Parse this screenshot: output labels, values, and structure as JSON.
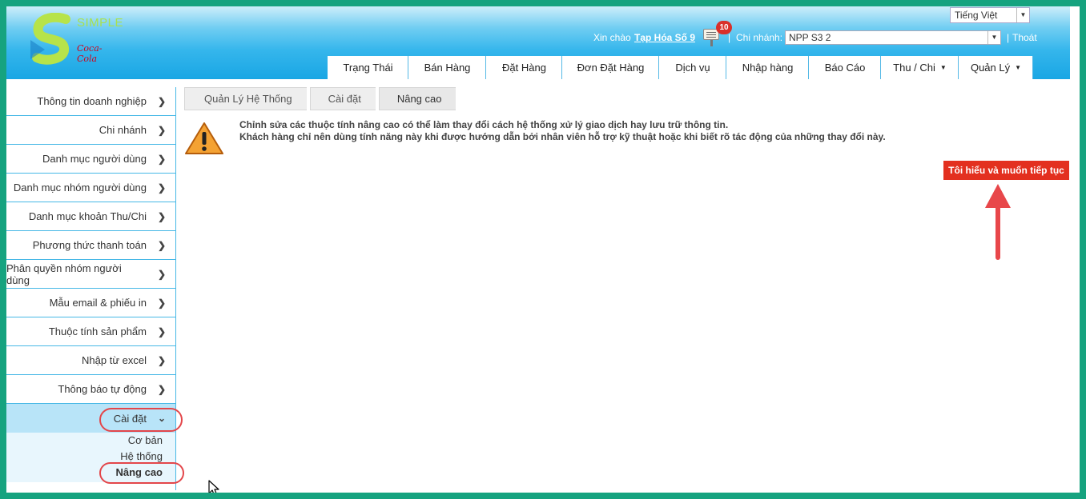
{
  "header": {
    "logo_text": "SIMPLE",
    "logo_sub": "Coca-Cola",
    "language": "Tiếng Việt",
    "greeting": "Xin chào",
    "shop_name": "Tạp Hóa Số 9",
    "notification_count": "10",
    "separator": "|",
    "branch_label": "Chi nhánh:",
    "branch_value": "NPP S3 2",
    "logout": "Thoát"
  },
  "tabs": [
    {
      "label": "Trạng Thái",
      "dropdown": false
    },
    {
      "label": "Bán Hàng",
      "dropdown": false
    },
    {
      "label": "Đặt Hàng",
      "dropdown": false
    },
    {
      "label": "Đơn Đặt Hàng",
      "dropdown": false
    },
    {
      "label": "Dịch vụ",
      "dropdown": false
    },
    {
      "label": "Nhập hàng",
      "dropdown": false
    },
    {
      "label": "Báo Cáo",
      "dropdown": false
    },
    {
      "label": "Thu / Chi",
      "dropdown": true
    },
    {
      "label": "Quản Lý",
      "dropdown": true
    }
  ],
  "sidebar": {
    "items": [
      {
        "label": "Thông tin doanh nghiệp"
      },
      {
        "label": "Chi nhánh"
      },
      {
        "label": "Danh mục người dùng"
      },
      {
        "label": "Danh mục nhóm người dùng"
      },
      {
        "label": "Danh mục khoản Thu/Chi"
      },
      {
        "label": "Phương thức thanh toán"
      },
      {
        "label": "Phân quyền nhóm người dùng"
      },
      {
        "label": "Mẫu email & phiếu in"
      },
      {
        "label": "Thuộc tính sản phẩm"
      },
      {
        "label": "Nhập từ excel"
      },
      {
        "label": "Thông báo tự động"
      }
    ],
    "active": {
      "label": "Cài đặt"
    },
    "sub_items": [
      {
        "label": "Cơ bản"
      },
      {
        "label": "Hệ thống"
      },
      {
        "label": "Nâng cao"
      }
    ]
  },
  "breadcrumb": [
    "Quản Lý Hệ Thống",
    "Cài đặt",
    "Nâng cao"
  ],
  "warning": {
    "line1": "Chỉnh sửa các thuộc tính nâng cao có thể làm thay đổi cách hệ thống xử lý giao dịch hay lưu trữ thông tin.",
    "line2": "Khách hàng chỉ nên dùng tính năng này khi được hướng dẫn bởi nhân viên hỗ trợ kỹ thuật hoặc khi biết rõ tác động của những thay đổi này."
  },
  "continue_button": "Tôi hiểu và muốn tiếp tục",
  "colors": {
    "frame": "#16a37f",
    "header_blue": "#19a6e4",
    "button_red": "#e3301f",
    "annotation_red": "#e3464a"
  }
}
